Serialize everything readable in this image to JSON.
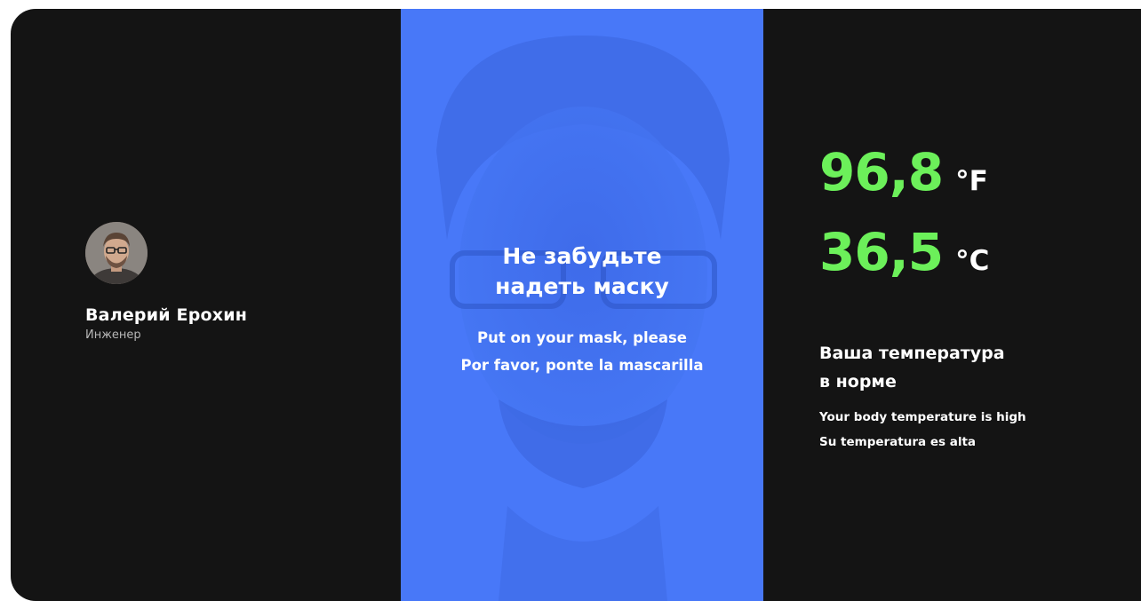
{
  "profile": {
    "avatar": "person-photo-icon",
    "name": "Валерий Ерохин",
    "role": "Инженер"
  },
  "camera": {
    "title_lines": [
      "Не забудьте",
      "надеть маску"
    ],
    "subtitle_lines": [
      "Put on your mask, please",
      "Por favor, ponte la mascarilla"
    ],
    "tint_color": "#4878f8"
  },
  "temperature": {
    "fahrenheit_value": "96,8",
    "fahrenheit_unit": "°F",
    "celsius_value": "36,5",
    "celsius_unit": "°C",
    "value_color": "#6cf05a",
    "status_lines": [
      "Ваша температура",
      "в норме"
    ],
    "sub_lines": [
      "Your body temperature is high",
      "Su temperatura es alta"
    ]
  }
}
